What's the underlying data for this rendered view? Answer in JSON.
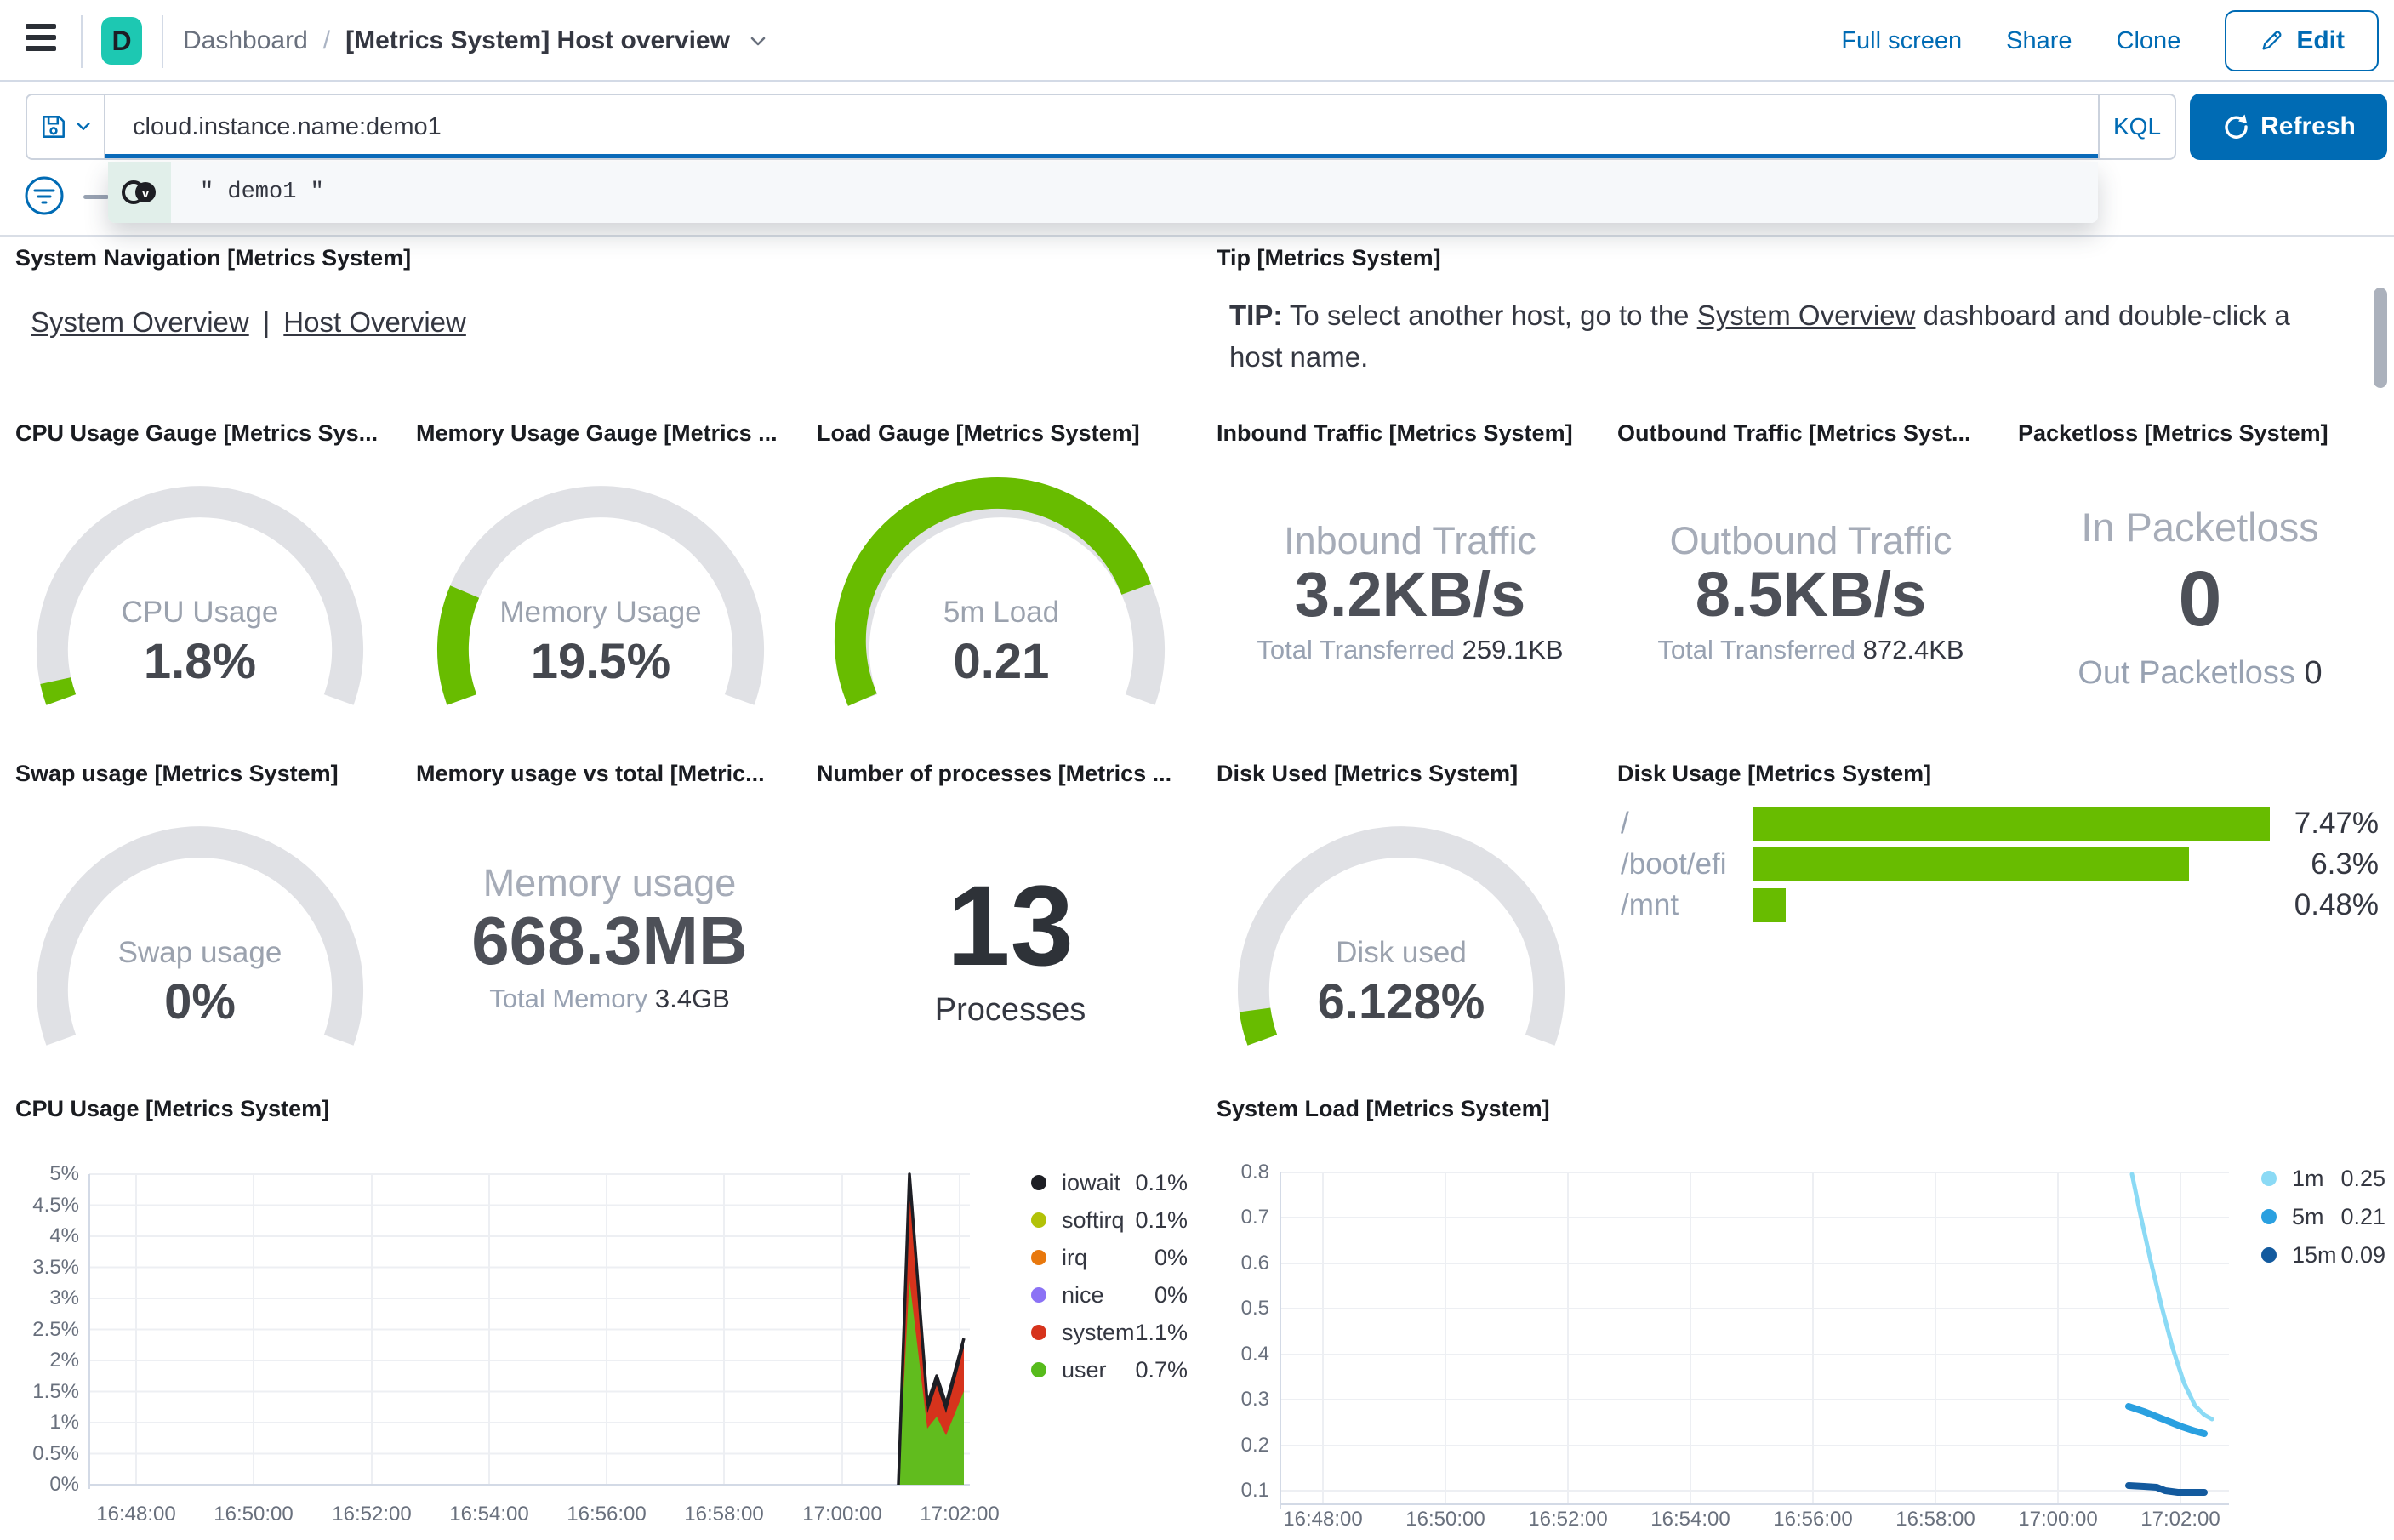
{
  "header": {
    "logo_letter": "D",
    "breadcrumb_root": "Dashboard",
    "breadcrumb_sep": "/",
    "title": "[Metrics System] Host overview",
    "actions": {
      "full_screen": "Full screen",
      "share": "Share",
      "clone": "Clone",
      "edit": "Edit"
    }
  },
  "query_bar": {
    "query": "cloud.instance.name:demo1",
    "language": "KQL",
    "refresh": "Refresh",
    "suggestion": "\" demo1 \"",
    "plus": "+"
  },
  "nav_panel": {
    "title": "System Navigation [Metrics System]",
    "link1": "System Overview",
    "separator": "|",
    "link2": "Host Overview"
  },
  "tip_panel": {
    "title": "Tip [Metrics System]",
    "tip_bold": "TIP:",
    "before_link": " To select another host, go to the ",
    "link": "System Overview",
    "after_link": " dashboard and double-click a host name."
  },
  "gauges": {
    "cpu": {
      "title": "CPU Usage Gauge [Metrics Sys...",
      "label": "CPU Usage",
      "value": "1.8%"
    },
    "memory": {
      "title": "Memory Usage Gauge [Metrics ...",
      "label": "Memory Usage",
      "value": "19.5%"
    },
    "load": {
      "title": "Load Gauge [Metrics System]",
      "label": "5m Load",
      "value": "0.21"
    },
    "swap": {
      "title": "Swap usage [Metrics System]",
      "label": "Swap usage",
      "value": "0%"
    },
    "disk": {
      "title": "Disk Used [Metrics System]",
      "label": "Disk used",
      "value": "6.128%"
    }
  },
  "inbound": {
    "title": "Inbound Traffic [Metrics System]",
    "label": "Inbound Traffic",
    "value": "3.2KB/s",
    "sub_label": "Total Transferred",
    "sub_value": "259.1KB"
  },
  "outbound": {
    "title": "Outbound Traffic [Metrics Syst...",
    "label": "Outbound Traffic",
    "value": "8.5KB/s",
    "sub_label": "Total Transferred",
    "sub_value": "872.4KB"
  },
  "packetloss": {
    "title": "Packetloss [Metrics System]",
    "in_label": "In Packetloss",
    "in_value": "0",
    "out_label": "Out Packetloss",
    "out_value": "0"
  },
  "memory_total": {
    "title": "Memory usage vs total [Metric...",
    "label": "Memory usage",
    "value": "668.3MB",
    "sub_label": "Total Memory",
    "sub_value": "3.4GB"
  },
  "processes": {
    "title": "Number of processes [Metrics ...",
    "value": "13",
    "label": "Processes"
  },
  "disk_usage": {
    "title": "Disk Usage [Metrics System]",
    "rows": [
      {
        "label": "/",
        "value": "7.47%"
      },
      {
        "label": "/boot/efi",
        "value": "6.3%"
      },
      {
        "label": "/mnt",
        "value": "0.48%"
      }
    ]
  },
  "cpu_chart": {
    "title": "CPU Usage [Metrics System]",
    "y_ticks": [
      "5%",
      "4.5%",
      "4%",
      "3.5%",
      "3%",
      "2.5%",
      "2%",
      "1.5%",
      "1%",
      "0.5%",
      "0%"
    ],
    "x_ticks": [
      "16:48:00",
      "16:50:00",
      "16:52:00",
      "16:54:00",
      "16:56:00",
      "16:58:00",
      "17:00:00",
      "17:02:00"
    ],
    "legend": [
      {
        "label": "iowait",
        "value": "0.1%"
      },
      {
        "label": "softirq",
        "value": "0.1%"
      },
      {
        "label": "irq",
        "value": "0%"
      },
      {
        "label": "nice",
        "value": "0%"
      },
      {
        "label": "system",
        "value": "1.1%"
      },
      {
        "label": "user",
        "value": "0.7%"
      }
    ]
  },
  "load_chart": {
    "title": "System Load [Metrics System]",
    "y_ticks": [
      "0.8",
      "0.7",
      "0.6",
      "0.5",
      "0.4",
      "0.3",
      "0.2",
      "0.1"
    ],
    "x_ticks": [
      "16:48:00",
      "16:50:00",
      "16:52:00",
      "16:54:00",
      "16:56:00",
      "16:58:00",
      "17:00:00",
      "17:02:00"
    ],
    "legend": [
      {
        "label": "1m",
        "value": "0.25"
      },
      {
        "label": "5m",
        "value": "0.21"
      },
      {
        "label": "15m",
        "value": "0.09"
      }
    ]
  },
  "colors": {
    "brand_teal": "#1DC8B2",
    "primary_blue": "#006BB4",
    "gauge_green": "#68BC00",
    "gauge_track": "#E0E1E5",
    "series_iowait": "#1D1E24",
    "series_softirq": "#B2C208",
    "series_irq": "#E8780D",
    "series_nice": "#8B72F5",
    "series_system": "#D6331C",
    "series_user": "#57BB1C",
    "load_1m": "#8BDAF5",
    "load_5m": "#2AA0E0",
    "load_15m": "#135A9E"
  },
  "chart_data": [
    {
      "type": "gauge",
      "title": "CPU Usage Gauge [Metrics System]",
      "label": "CPU Usage",
      "value": 1.8,
      "unit": "%",
      "max": 100
    },
    {
      "type": "gauge",
      "title": "Memory Usage Gauge [Metrics System]",
      "label": "Memory Usage",
      "value": 19.5,
      "unit": "%",
      "max": 100
    },
    {
      "type": "gauge",
      "title": "Load Gauge [Metrics System]",
      "label": "5m Load",
      "value": 0.21
    },
    {
      "type": "gauge",
      "title": "Swap usage [Metrics System]",
      "label": "Swap usage",
      "value": 0,
      "unit": "%",
      "max": 100
    },
    {
      "type": "gauge",
      "title": "Disk Used [Metrics System]",
      "label": "Disk used",
      "value": 6.128,
      "unit": "%",
      "max": 100
    },
    {
      "type": "bar",
      "title": "Disk Usage [Metrics System]",
      "orientation": "horizontal",
      "categories": [
        "/",
        "/boot/efi",
        "/mnt"
      ],
      "values": [
        7.47,
        6.3,
        0.48
      ],
      "unit": "%",
      "bar_color": "#68BC00"
    },
    {
      "type": "area",
      "stacked": true,
      "title": "CPU Usage [Metrics System]",
      "x": [
        "17:01:00",
        "17:01:10",
        "17:01:30",
        "17:01:45",
        "17:02:00",
        "17:02:25"
      ],
      "series": [
        {
          "name": "user",
          "values": [
            0,
            3.3,
            0.9,
            1.1,
            0.8,
            1.5
          ]
        },
        {
          "name": "system",
          "values": [
            0,
            1.5,
            0.25,
            0.45,
            0.35,
            0.7
          ]
        },
        {
          "name": "iowait",
          "values": [
            0,
            0.2,
            0.15,
            0.2,
            0.15,
            0.15
          ]
        },
        {
          "name": "softirq",
          "values": [
            0,
            0.05,
            0.05,
            0.05,
            0.05,
            0.05
          ]
        },
        {
          "name": "irq",
          "values": [
            0,
            0,
            0,
            0,
            0,
            0
          ]
        },
        {
          "name": "nice",
          "values": [
            0,
            0,
            0,
            0,
            0,
            0
          ]
        }
      ],
      "xlabel": "",
      "ylabel": "%",
      "ylim": [
        0,
        5
      ],
      "x_range": [
        "16:47:00",
        "17:02:30"
      ],
      "grid": true,
      "legend_position": "right"
    },
    {
      "type": "line",
      "title": "System Load [Metrics System]",
      "x": [
        "17:01:10",
        "17:01:25",
        "17:01:40",
        "17:01:55",
        "17:02:10",
        "17:02:20"
      ],
      "series": [
        {
          "name": "1m",
          "values": [
            0.8,
            0.66,
            0.5,
            0.37,
            0.28,
            0.25
          ]
        },
        {
          "name": "5m",
          "values": [
            0.27,
            0.26,
            0.25,
            0.23,
            0.22,
            0.21
          ]
        },
        {
          "name": "15m",
          "values": [
            0.1,
            0.1,
            0.1,
            0.09,
            0.09,
            0.09
          ]
        }
      ],
      "xlabel": "",
      "ylabel": "",
      "ylim": [
        0.1,
        0.8
      ],
      "x_range": [
        "16:47:00",
        "17:02:30"
      ],
      "grid": true,
      "legend_position": "right"
    }
  ]
}
